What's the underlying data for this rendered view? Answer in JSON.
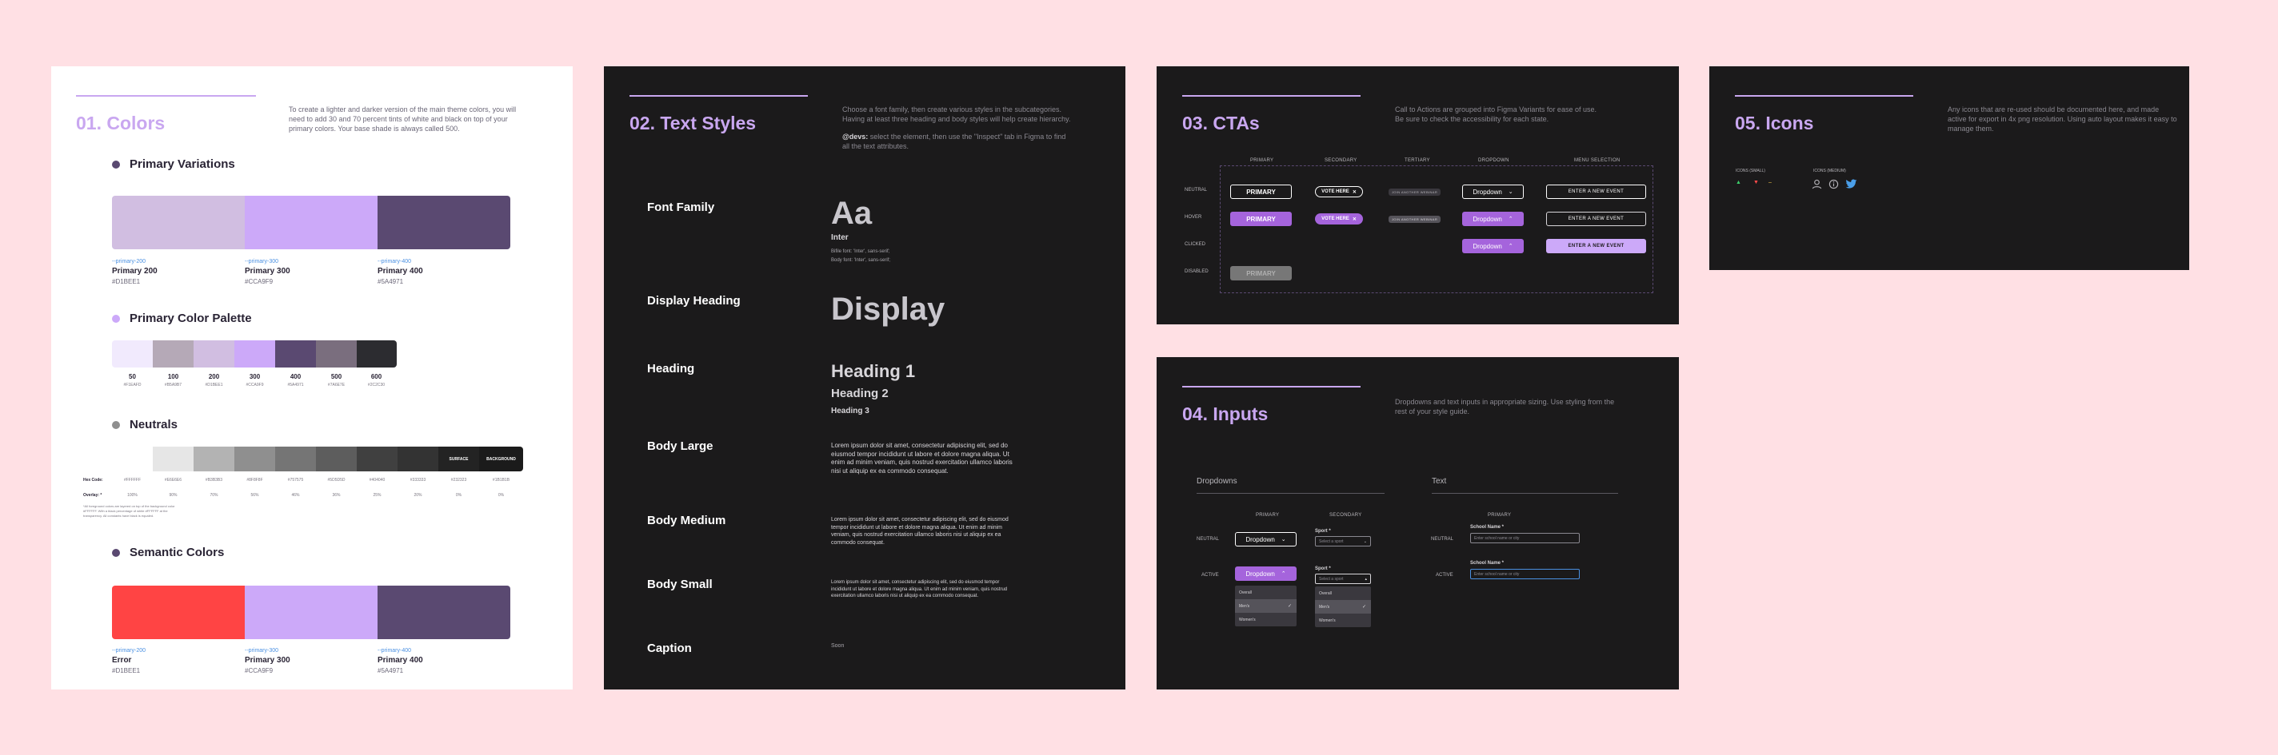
{
  "colors": {
    "title": "01. Colors",
    "desc": "To create a lighter and darker version of the main theme colors, you will need to add 30 and 70 percent tints of white and black on top of your primary colors. Your base shade is always called 500.",
    "primary_variations": {
      "heading": "Primary Variations",
      "swatches": [
        {
          "sub": "--primary-200",
          "name": "Primary 200",
          "hex": "#D1BEE1",
          "color": "#d1bee1"
        },
        {
          "sub": "--primary-300",
          "name": "Primary 300",
          "hex": "#CCA9F9",
          "color": "#cca9f9"
        },
        {
          "sub": "--primary-400",
          "name": "Primary 400",
          "hex": "#5A4971",
          "color": "#5a4971"
        }
      ]
    },
    "palette": {
      "heading": "Primary Color Palette",
      "cells": [
        {
          "label": "50",
          "hex": "#F1EAFD",
          "color": "#f1eafd"
        },
        {
          "label": "100",
          "hex": "#B5A9B7",
          "color": "#b5a9b7"
        },
        {
          "label": "200",
          "hex": "#D1BEE1",
          "color": "#d1bee1"
        },
        {
          "label": "300",
          "hex": "#CCA9F9",
          "color": "#cca9f9"
        },
        {
          "label": "400",
          "hex": "#5A4971",
          "color": "#5a4971"
        },
        {
          "label": "500",
          "hex": "#7A6E7E",
          "color": "#7a6e7e"
        },
        {
          "label": "600",
          "hex": "#2C2C30",
          "color": "#2c2c30"
        }
      ]
    },
    "neutrals": {
      "heading": "Neutrals",
      "hex_label": "Hex Code:",
      "overlay_label": "Overlay: *",
      "note": "*All foreground colors are layered on top of the background color #FFFFFF. With a black percentage of white #FFFFFF at the transparency. All constants have black is equaled.",
      "cells": [
        {
          "color": "#ffffff",
          "hex": "#FFFFFF",
          "overlay": "100%",
          "text": ""
        },
        {
          "color": "#e6e6e6",
          "hex": "#E6E6E6",
          "overlay": "90%",
          "text": ""
        },
        {
          "color": "#b3b3b3",
          "hex": "#B3B3B3",
          "overlay": "70%",
          "text": ""
        },
        {
          "color": "#8f8f8f",
          "hex": "#8F8F8F",
          "overlay": "56%",
          "text": ""
        },
        {
          "color": "#757575",
          "hex": "#757575",
          "overlay": "46%",
          "text": ""
        },
        {
          "color": "#5d5d5d",
          "hex": "#5D5D5D",
          "overlay": "36%",
          "text": ""
        },
        {
          "color": "#404040",
          "hex": "#404040",
          "overlay": "25%",
          "text": ""
        },
        {
          "color": "#333333",
          "hex": "#333333",
          "overlay": "20%",
          "text": ""
        },
        {
          "color": "#232323",
          "hex": "#232323",
          "overlay": "0%",
          "text": "SURFACE"
        },
        {
          "color": "#1b1b1b",
          "hex": "#1B1B1B",
          "overlay": "0%",
          "text": "BACKGROUND"
        }
      ]
    },
    "semantic": {
      "heading": "Semantic Colors",
      "swatches": [
        {
          "sub": "--primary-200",
          "name": "Error",
          "hex": "#D1BEE1",
          "color": "#ff4444"
        },
        {
          "sub": "--primary-300",
          "name": "Primary 300",
          "hex": "#CCA9F9",
          "color": "#cca9f9"
        },
        {
          "sub": "--primary-400",
          "name": "Primary 400",
          "hex": "#5A4971",
          "color": "#5a4971"
        }
      ]
    }
  },
  "text_styles": {
    "title": "02. Text Styles",
    "desc1": "Choose a font family, then create various styles in the subcategories. Having at least three heading and body styles will help create hierarchy.",
    "desc2_bold": "@devs:",
    "desc2": " select the element, then use the \"Inspect\" tab in Figma to find all the text attributes.",
    "rows": {
      "font_family": {
        "label": "Font Family",
        "big": "Aa",
        "name": "Inter",
        "css1": "Bifile font: 'Inter', sans-serif;",
        "css2": "Body font: 'Inter', sans-serif;"
      },
      "display": {
        "label": "Display Heading",
        "sample": "Display"
      },
      "heading": {
        "label": "Heading",
        "h1": "Heading 1",
        "h2": "Heading 2",
        "h3": "Heading 3"
      },
      "body_large": {
        "label": "Body Large",
        "sample": "Lorem ipsum dolor sit amet, consectetur adipiscing elit, sed do eiusmod tempor incididunt ut labore et dolore magna aliqua. Ut enim ad minim veniam, quis nostrud exercitation ullamco laboris nisi ut aliquip ex ea commodo consequat."
      },
      "body_medium": {
        "label": "Body Medium",
        "sample": "Lorem ipsum dolor sit amet, consectetur adipiscing elit, sed do eiusmod tempor incididunt ut labore et dolore magna aliqua. Ut enim ad minim veniam, quis nostrud exercitation ullamco laboris nisi ut aliquip ex ea commodo consequat."
      },
      "body_small": {
        "label": "Body Small",
        "sample": "Lorem ipsum dolor sit amet, consectetur adipiscing elit, sed do eiusmod tempor incididunt ut labore et dolore magna aliqua. Ut enim ad minim veniam, quis nostrud exercitation ullamco laboris nisi ut aliquip ex ea commodo consequat."
      },
      "caption": {
        "label": "Caption",
        "sample": "Soon"
      }
    }
  },
  "ctas": {
    "title": "03. CTAs",
    "desc": "Call to Actions are grouped into Figma Variants for ease of use. Be sure to check the accessibility for each state.",
    "columns": [
      "PRIMARY",
      "SECONDARY",
      "TERTIARY",
      "DROPDOWN",
      "MENU SELECTION"
    ],
    "rows": [
      "NEUTRAL",
      "HOVER",
      "CLICKED",
      "DISABLED"
    ],
    "primary_label": "PRIMARY",
    "vote_label": "VOTE HERE",
    "tertiary_label": "JOIN ANOTHER WEBINAR",
    "dropdown_label": "Dropdown",
    "menu_label": "ENTER A NEW EVENT"
  },
  "icons": {
    "title": "05. Icons",
    "desc": "Any icons that are re-used should be documented here, and made active for export in 4x png resolution. Using auto layout makes it easy to manage them.",
    "small_label": "ICONS (SMALL)",
    "medium_label": "ICONS (MEDIUM)"
  },
  "inputs": {
    "title": "04. Inputs",
    "desc": "Dropdowns and text inputs in appropriate sizing. Use styling from the rest of your style guide.",
    "dropdowns_heading": "Dropdowns",
    "text_heading": "Text",
    "col_primary": "PRIMARY",
    "col_secondary": "SECONDARY",
    "row_neutral": "NEUTRAL",
    "row_active": "ACTIVE",
    "dropdown_label": "Dropdown",
    "sport_label": "Sport *",
    "sport_placeholder": "Select a sport",
    "menu_items": [
      "Overall",
      "Men's",
      "Women's"
    ],
    "menu_items_secondary": [
      "Overall",
      "Men's",
      "Women's"
    ],
    "school_label": "School Name *",
    "school_placeholder": "Enter school name or city"
  }
}
